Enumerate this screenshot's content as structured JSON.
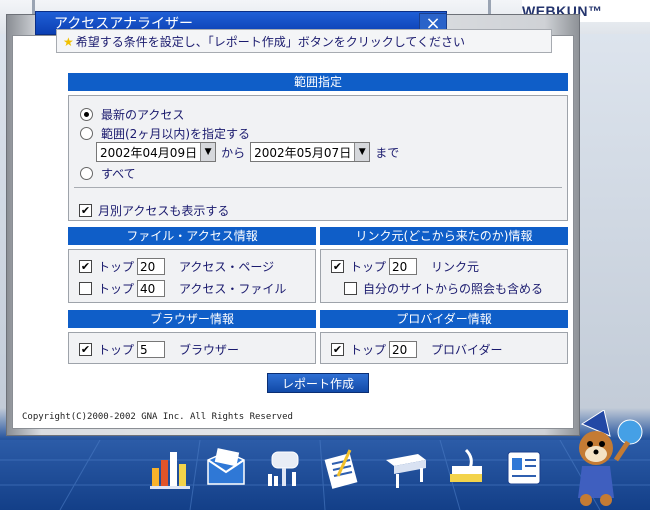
{
  "brand": {
    "logo": "WEBKUN™"
  },
  "window": {
    "title": "アクセスアナライザー",
    "close": "×"
  },
  "notice": {
    "star": "★",
    "text": "希望する条件を設定し、「レポート作成」ボタンをクリックしてください"
  },
  "range": {
    "header": "範囲指定",
    "opt_latest": "最新のアクセス",
    "opt_range": "範囲(2ヶ月以内)を指定する",
    "from_date": "2002年04月09日",
    "kara": "から",
    "to_date": "2002年05月07日",
    "made": "まで",
    "opt_all": "すべて",
    "monthly": "月別アクセスも表示する",
    "selected": "latest"
  },
  "file_access": {
    "header": "ファイル・アクセス情報",
    "rows": [
      {
        "top": "トップ",
        "count": "20",
        "label": "アクセス・ページ",
        "checked": true
      },
      {
        "top": "トップ",
        "count": "40",
        "label": "アクセス・ファイル",
        "checked": false
      }
    ]
  },
  "link_source": {
    "header": "リンク元(どこから来たのか)情報",
    "top": "トップ",
    "count": "20",
    "label": "リンク元",
    "checked": true,
    "self_label": "自分のサイトからの照会も含める",
    "self_checked": false
  },
  "browser": {
    "header": "ブラウザー情報",
    "top": "トップ",
    "count": "5",
    "label": "ブラウザー",
    "checked": true
  },
  "provider": {
    "header": "プロバイダー情報",
    "top": "トップ",
    "count": "20",
    "label": "プロバイダー",
    "checked": true
  },
  "report_button": "レポート作成",
  "copyright": "Copyright(C)2000-2002 GNA Inc. All Rights Reserved",
  "taskbar": {
    "icons": [
      "bar-chart-icon",
      "mail-icon",
      "mailbox-icon",
      "edit-icon",
      "table-icon",
      "books-icon",
      "address-card-icon",
      "mascot-icon"
    ]
  }
}
